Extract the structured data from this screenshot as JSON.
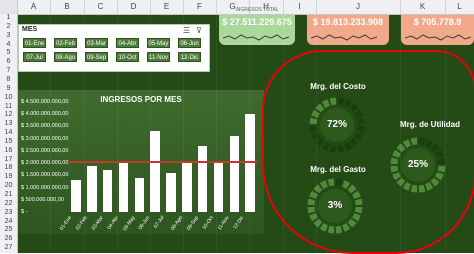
{
  "columns": [
    "A",
    "B",
    "C",
    "D",
    "E",
    "F",
    "G",
    "H",
    "I",
    "J",
    "K",
    "L"
  ],
  "rows": [
    "1",
    "2",
    "3",
    "4",
    "5",
    "6",
    "7",
    "8",
    "9",
    "10",
    "11",
    "12",
    "13",
    "14",
    "15",
    "16",
    "17",
    "18",
    "19",
    "20",
    "21",
    "22",
    "23",
    "24",
    "25",
    "26",
    "27"
  ],
  "slicer": {
    "title": "MES",
    "items": [
      "01-Ene",
      "02-Feb",
      "03-Mar",
      "04-Abr",
      "05-May",
      "06-Jun",
      "07-Jul",
      "08-Ago",
      "09-Sep",
      "10-Oct",
      "11-Nov",
      "12-Dic"
    ]
  },
  "kpis": [
    {
      "caption": "INGRESOS TOTAL",
      "value": "$ 27.511.229.675",
      "color": "#a9d89a",
      "text": "#ffffff"
    },
    {
      "caption": "",
      "value": "$ 19.813.233.908",
      "color": "#f2a98a",
      "text": "#ffffff"
    },
    {
      "caption": "",
      "value": "$ 705.778.9",
      "color": "#f2a98a",
      "text": "#ffffff"
    }
  ],
  "chart_data": {
    "type": "bar",
    "title": "INGRESOS POR MES",
    "categories": [
      "01-Ene",
      "02-Feb",
      "03-Mar",
      "04-Abr",
      "05-May",
      "06-Jun",
      "07-Jul",
      "08-Ago",
      "09-Sep",
      "10-Oct",
      "11-Nov",
      "12-Dic"
    ],
    "values": [
      1300000000,
      1900000000,
      1700000000,
      2000000000,
      1400000000,
      3300000000,
      1600000000,
      2000000000,
      2700000000,
      2000000000,
      3100000000,
      4000000000
    ],
    "average": 2100000000,
    "yticks": [
      "$ 4.500.000.000,00",
      "$ 4.000.000.000,00",
      "$ 3.500.000.000,00",
      "$ 3.000.000.000,00",
      "$ 2.500.000.000,00",
      "$ 2.000.000.000,00",
      "$ 1.500.000.000,00",
      "$ 1.000.000.000,00",
      "$ 500.000.000,00",
      "$ -"
    ],
    "ylim": [
      0,
      4500000000
    ],
    "grid": false
  },
  "gauges": [
    {
      "label": "Mrg. del Costo",
      "value": "72%",
      "fraction": 0.72
    },
    {
      "label": "Mrg. de Utilidad",
      "value": "25%",
      "fraction": 0.25
    },
    {
      "label": "Mrg. del Gasto",
      "value": "3%",
      "fraction": 0.03
    }
  ],
  "colors": {
    "sheet_bg": "#244a16",
    "gauge_ring": "#4f8a38",
    "gauge_fill": "#1b3d0f",
    "annotation": "#e8000b"
  }
}
